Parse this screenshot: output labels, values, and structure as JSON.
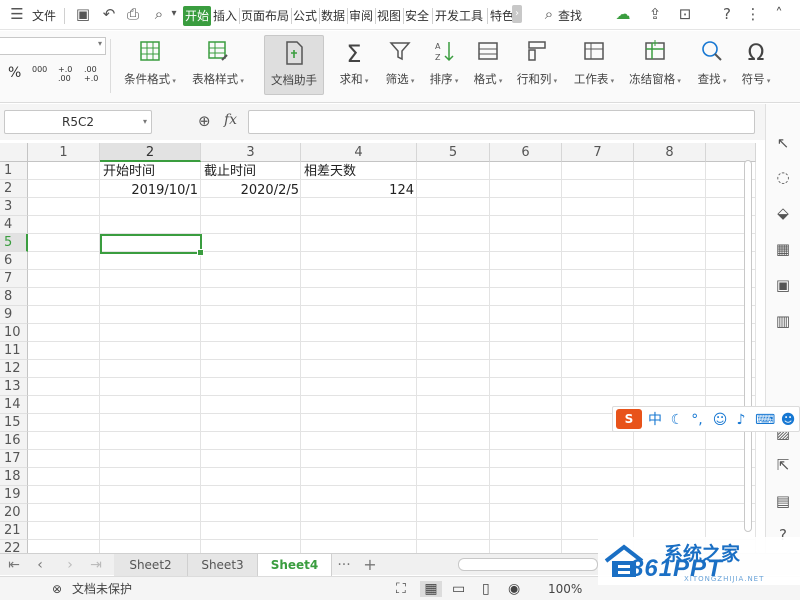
{
  "menubar": {
    "file_label": "文件",
    "tabs": [
      "开始",
      "插入",
      "页面布局",
      "公式",
      "数据",
      "审阅",
      "视图",
      "安全",
      "开发工具",
      "特色"
    ],
    "active_tab": "开始",
    "search_label": "查找"
  },
  "ribbon": {
    "font_controls": {
      "percent": "%",
      "thousands": "000",
      "inc_decimal": "+.0 .00",
      "dec_decimal": ".00 +.0"
    },
    "buttons": [
      "条件格式",
      "表格样式",
      "文档助手",
      "求和",
      "筛选",
      "排序",
      "格式",
      "行和列",
      "工作表",
      "冻结窗格",
      "查找",
      "符号"
    ]
  },
  "formula_bar": {
    "name_box": "R5C2",
    "fx_label": "fx",
    "formula_value": ""
  },
  "grid": {
    "columns": [
      "1",
      "2",
      "3",
      "4",
      "5",
      "6",
      "7",
      "8"
    ],
    "rows": [
      "1",
      "2",
      "3",
      "4",
      "5",
      "6",
      "7",
      "8",
      "9",
      "10",
      "11",
      "12",
      "13",
      "14",
      "15",
      "16",
      "17",
      "18",
      "19",
      "20",
      "21",
      "22"
    ],
    "selected_column": "2",
    "selected_row": "5",
    "cells": {
      "r1c2": "开始时间",
      "r1c3": "截止时间",
      "r1c4": "相差天数",
      "r2c2": "2019/10/1",
      "r2c3": "2020/2/5",
      "r2c4": "124"
    }
  },
  "sheet_tabs": {
    "tabs": [
      "Sheet2",
      "Sheet3",
      "Sheet4"
    ],
    "active": "Sheet4",
    "more_label": "···",
    "add_label": "+"
  },
  "status_bar": {
    "protect_label": "文档未保护",
    "zoom": "100%"
  },
  "ime": {
    "logo": "S",
    "mode": "中"
  },
  "watermark": {
    "chinese": "系统之家",
    "brand": "861PPT",
    "sub": "XITONGZHIJIA.NET"
  },
  "colors": {
    "accent": "#3a9d3f",
    "watermark_blue": "#1a6fc4",
    "ime_orange": "#e8531a"
  }
}
